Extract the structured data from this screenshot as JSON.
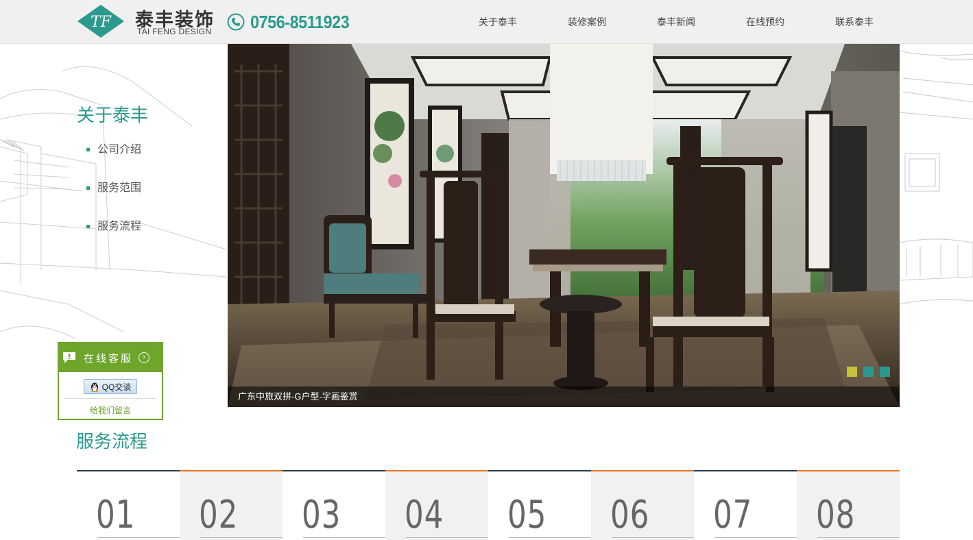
{
  "header": {
    "logo_cn": "泰丰装饰",
    "logo_en": "TAI FENG DESIGN",
    "logo_mark_text": "TF",
    "phone": "0756-8511923",
    "nav": [
      "关于泰丰",
      "装修案例",
      "泰丰新闻",
      "在线预约",
      "联系泰丰"
    ]
  },
  "sidebar": {
    "title": "关于泰丰",
    "items": [
      "公司介绍",
      "服务范围",
      "服务流程"
    ]
  },
  "service": {
    "title": "在线客服",
    "qq_label": "QQ交谈",
    "message_link": "给我们留言"
  },
  "banner": {
    "caption": "广东中旅双拼-G户型-字画鉴赏",
    "dots": [
      {
        "color": "#c8c13a",
        "active": true
      },
      {
        "color": "#2a9a8e",
        "active": false
      },
      {
        "color": "#2a9a8e",
        "active": false
      }
    ]
  },
  "process": {
    "title": "服务流程",
    "steps": [
      "01",
      "02",
      "03",
      "04",
      "05",
      "06",
      "07",
      "08"
    ]
  },
  "colors": {
    "accent": "#2a9a8e",
    "service_green": "#6ea52b",
    "step_orange": "#e87722",
    "step_dark": "#2c3a4a"
  }
}
